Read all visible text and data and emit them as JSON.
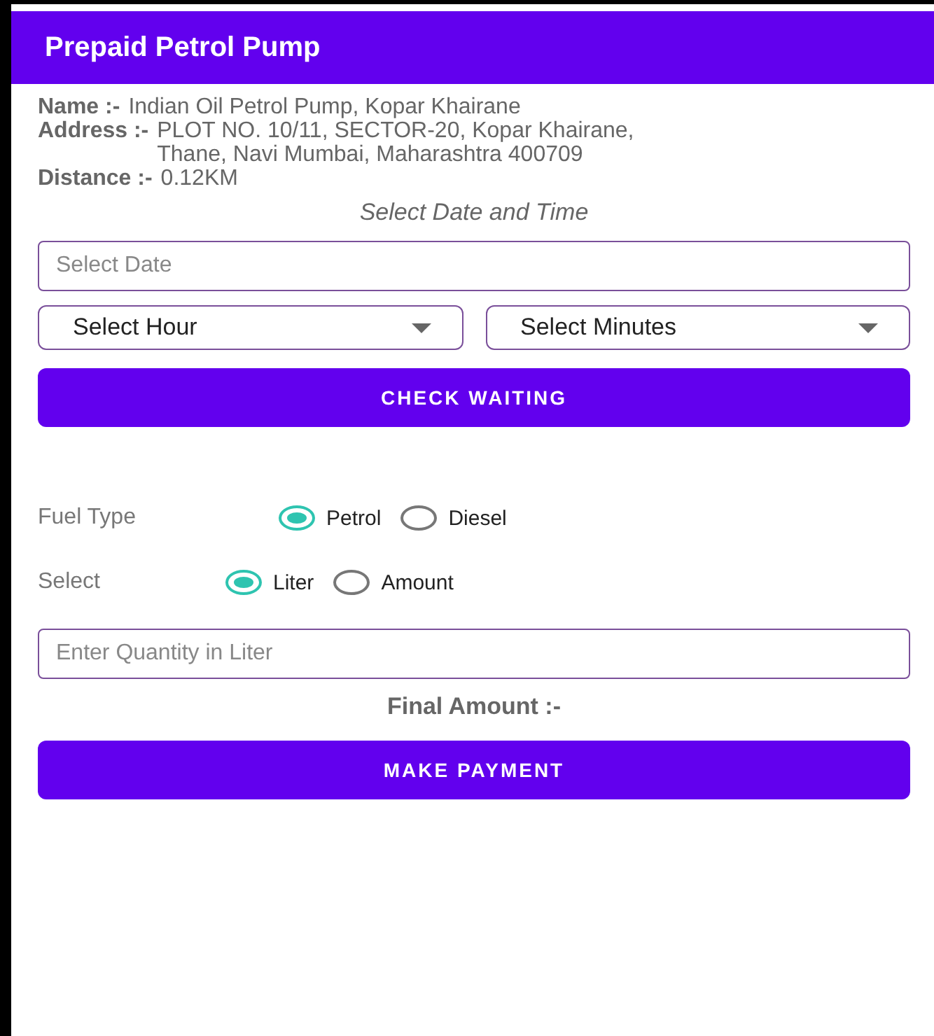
{
  "app_bar": {
    "title": "Prepaid Petrol Pump"
  },
  "details": [
    {
      "label": "Name :-",
      "value": "Indian Oil Petrol Pump, Kopar Khairane"
    },
    {
      "label": "Address :-",
      "value": "PLOT NO. 10/11, SECTOR-20, Kopar Khairane, Thane, Navi Mumbai, Maharashtra 400709"
    },
    {
      "label": "Distance :-",
      "value": "0.12KM"
    }
  ],
  "date_time_heading": "Select Date and Time",
  "date_field": {
    "placeholder": "Select Date"
  },
  "dropdowns": [
    {
      "value": "Select Hour"
    },
    {
      "value": "Select Minutes"
    }
  ],
  "check_button": "CHECK WAITING",
  "radio_groups": [
    {
      "label": "Fuel Type",
      "options": [
        {
          "label": "Petrol",
          "selected": true
        },
        {
          "label": "Diesel",
          "selected": false
        }
      ]
    },
    {
      "label": "Select",
      "options": [
        {
          "label": "Liter",
          "selected": true
        },
        {
          "label": "Amount",
          "selected": false
        }
      ]
    }
  ],
  "quantity_field": {
    "placeholder": "Enter Quantity in Liter"
  },
  "final_amount": "Final Amount :-",
  "payment_button": "MAKE PAYMENT"
}
